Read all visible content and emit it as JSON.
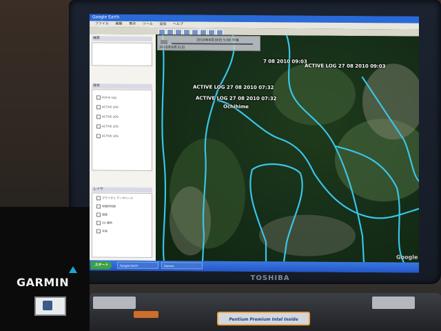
{
  "app": {
    "title": "Google Earth",
    "menu": [
      "ファイル",
      "編集",
      "表示",
      "ツール",
      "追加",
      "ヘルプ"
    ]
  },
  "sidebar": {
    "search_tab": "検索",
    "places_header": "保存",
    "layers_header": "レイヤ",
    "places_items": [
      "Active Log",
      "ACTIVE LOG",
      "ACTIVE LOG",
      "ACTIVE LOG",
      "ACTIVE LOG"
    ],
    "layers_items": [
      "プライマリ データベース",
      "地理的特徴",
      "道路",
      "3D 建物",
      "写真"
    ]
  },
  "map": {
    "time_slider": {
      "start": "2010年8月30日",
      "end": "5:00 午後",
      "current": "2010年8月31日"
    },
    "labels": [
      "ACTIVE LOG 27 08 2010 07:32",
      "ACTIVE LOG 27 08 2010 07:32",
      "Ochihime",
      "7 08 2010 09:03",
      "ACTIVE LOG 27 08 2010 09:03"
    ],
    "track_color": "#39c6e8",
    "attribution": "Google"
  },
  "taskbar": {
    "start_label": "スタート",
    "buttons": [
      "Google Earth",
      "Garmin"
    ]
  },
  "devices": {
    "laptop_brand": "TOSHIBA",
    "gps_brand": "GARMIN",
    "sticker": "Pentium Premium Intel Inside"
  }
}
